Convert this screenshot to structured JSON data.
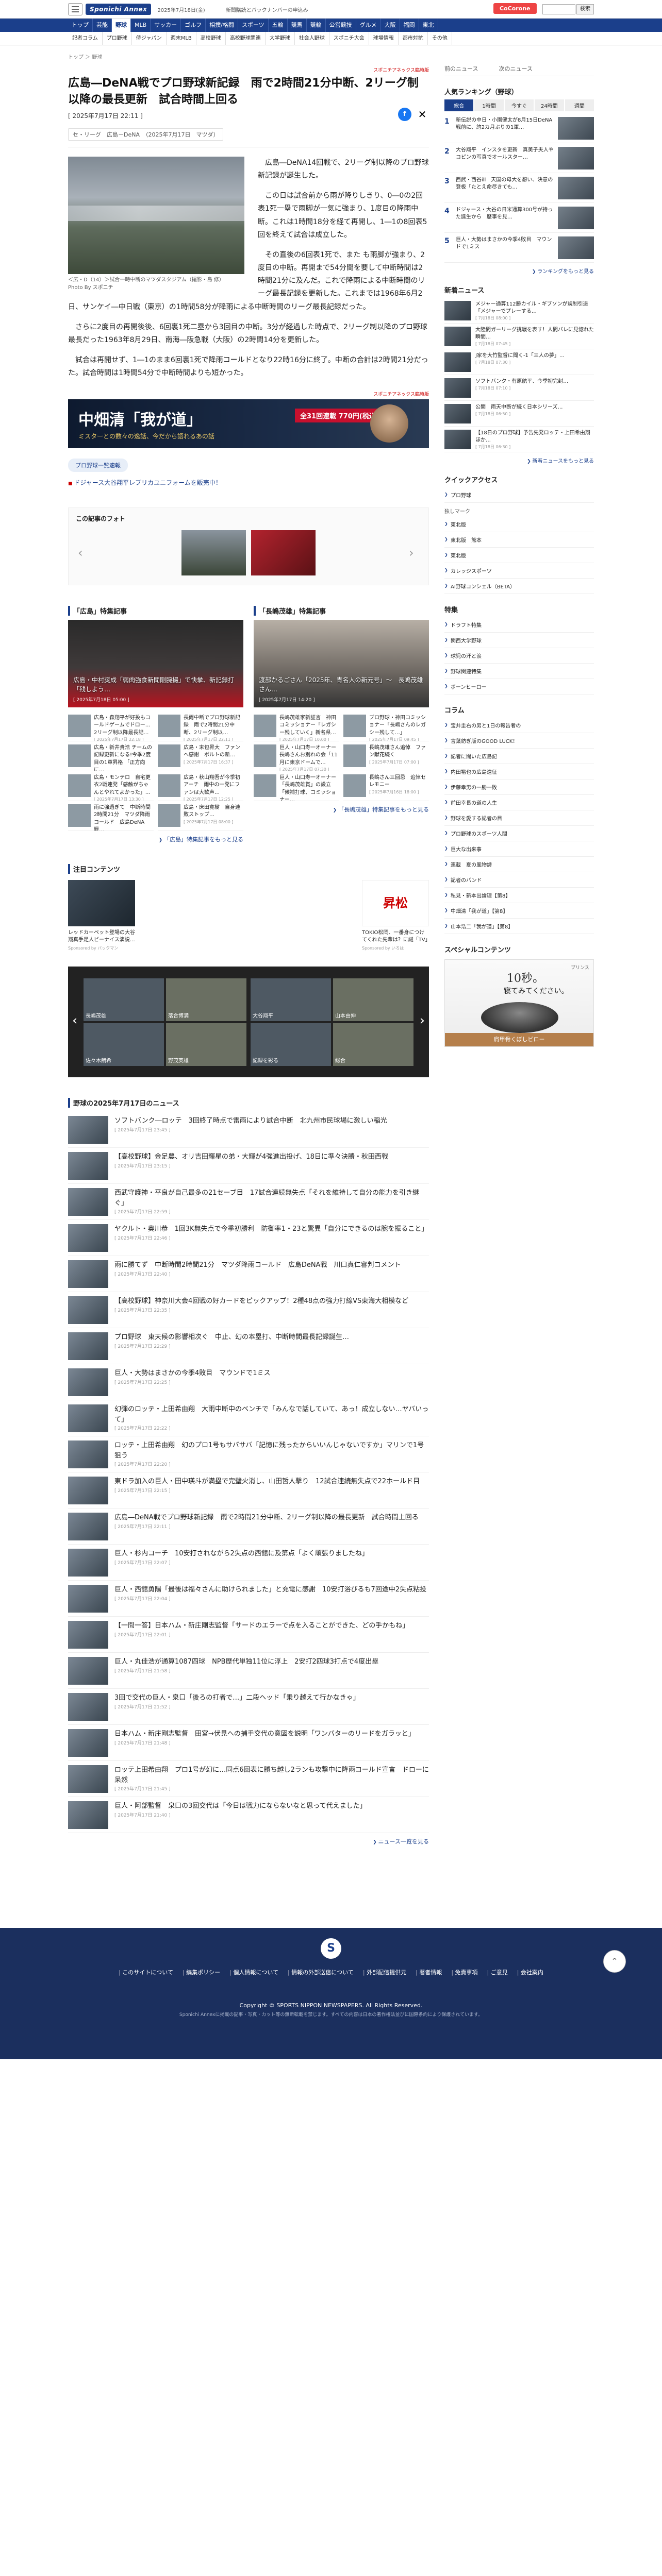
{
  "header": {
    "logo": "Sponichi Annex",
    "date": "2025年7月18日(金)",
    "notice": "新聞購読とバックナンバーの申込み",
    "cocorone": "CoCorone",
    "search_button": "検索"
  },
  "gnav": [
    "トップ",
    "芸能",
    "野球",
    "MLB",
    "サッカー",
    "ゴルフ",
    "相撲/格闘",
    "スポーツ",
    "五輪",
    "競馬",
    "競輪",
    "公営競技",
    "グルメ",
    "大阪",
    "福岡",
    "東北"
  ],
  "subnav": [
    "記者コラム",
    "プロ野球",
    "侍ジャパン",
    "週末MLB",
    "高校野球",
    "高校野球関連",
    "大学野球",
    "社会人野球",
    "スポニチ大会",
    "球場情報",
    "都市対抗",
    "その他"
  ],
  "breadcrumb": "トップ ＞ 野球",
  "ad_label": "スポニチアネックス臨時版",
  "article": {
    "headline": "広島―DeNA戦でプロ野球新記録　雨で2時間21分中断、2リーグ制以降の最長更新　試合時間上回る",
    "date": "[ 2025年7月17日 22:11 ]",
    "tags": [
      "セ・リーグ　広島－DeNA　（2025年7月17日　マツダ）"
    ],
    "photo_caption": "＜広・D（14）＞試合一時中断のマツダスタジアム（撮影・島 修）\nPhoto By スポニチ",
    "p1": "広島―DeNA14回戦で、2リーグ制以降のプロ野球新記録が誕生した。",
    "p2": "この日は試合前から雨が降りしきり、0―0の2回表1死一塁で雨脚が一気に強まり、1度目の降雨中断。これは1時間18分を経て再開し、1―1の8回表5回を終えて試合は成立した。",
    "p3": "その直後の6回表1死で、また も雨脚が強まり、2度目の中断。再開まで54分間を要して中断時間は2時間21分に及んだ。これで降雨による中断時間のリーグ最長記録を更新した。これまでは1968年6月2日、サンケイ―中日戦（東京）の1時間58分が降雨による中断時間のリーグ最長記録だった。",
    "p4": "さらに2度目の再開後後、6回裏1死二塁から3回目の中断。3分が経過した時点で、2リーグ制以降のプロ野球最長だった1963年8月29日、南海―阪急戦（大阪）の2時間14分を更新した。",
    "p5": "試合は再開せず、1―1のまま6回裏1死で降雨コールドとなり22時16分に終了。中断の合計は2時間21分だった。試合時間は1時間54分で中断時間よりも短かった。"
  },
  "banner": {
    "label": "スポニチアネックス臨時版",
    "title": "中畑清「我が道」",
    "subtitle": "ミスターとの数々の逸話、今だから語れるあの話",
    "price": "全31回連載 770円(税込)"
  },
  "pro_pill": "プロ野球一覧速報",
  "ext_link": "ドジャース大谷翔平レプリカユニフォームを販売中！",
  "photos": {
    "title": "この記事のフォト"
  },
  "features": [
    {
      "title": "「広島」特集記事",
      "hero_text": "広島・中村奨成「弱肉強食新聞剛腕撮」で快挙、新記録打 「残しよう…",
      "hero_date": "[ 2025年7月18日 05:00 ]",
      "items": [
        {
          "t": "広島・森翔平が好投もコールドゲームでドロー…2リーグ制以降最長記…",
          "d": "[ 2025年7月17日 22:18 ]"
        },
        {
          "t": "長雨中断でプロ野球新記録　雨で2時間21分中断、2リーグ制以…",
          "d": "[ 2025年7月17日 22:11 ]"
        },
        {
          "t": "広島・新井貴浩 チームの記録更新になる!今季2度目の1軍昇格 「正方向に…",
          "d": "[ 2025年7月17日 13:00 ]"
        },
        {
          "t": "広島・末包昇大　ファンへ感謝　ボルトの新…",
          "d": "[ 2025年7月17日 16:37 ]"
        },
        {
          "t": "広島・モンテロ　自宅更衣2戦連発「感触がちゃんとやれてよかった」…",
          "d": "[ 2025年7月17日 13:30 ]"
        },
        {
          "t": "広島・秋山翔吾が今季初アーチ　雨中の一発にファンは大歓声…",
          "d": "[ 2025年7月17日 12:25 ]"
        },
        {
          "t": "雨に強過ぎて　中断時間2時間21分　マツダ降雨コールド　広島DeNA戦…",
          "d": "[ 2025年7月17日 11:50 ]"
        },
        {
          "t": "広島・床田寛樹　自身連敗ストップ…",
          "d": "[ 2025年7月17日 08:00 ]"
        }
      ],
      "more": "「広島」特集記事をもっと見る"
    },
    {
      "title": "「長嶋茂雄」特集記事",
      "hero_text": "渡部かるごさん「2025年、青名人の新元号」～　長嶋茂雄さん…",
      "hero_date": "[ 2025年7月17日 14:20 ]",
      "items": [
        {
          "t": "長嶋茂雄家新証言　神田コミッショナー「レガシー残していく」新名県…",
          "d": "[ 2025年7月17日 10:00 ]"
        },
        {
          "t": "プロ野球・神田コミッショナー「長嶋さんのレガシー残して…」",
          "d": "[ 2025年7月17日 09:45 ]"
        },
        {
          "t": "巨人・山口寿一オーナー　長嶋さんお別れの会「11月に東京ドームで…",
          "d": "[ 2025年7月17日 07:30 ]"
        },
        {
          "t": "長嶋茂雄さん追悼　ファン献花続く",
          "d": "[ 2025年7月17日 07:00 ]"
        },
        {
          "t": "巨人・山口寿一オーナー「長嶋茂雄賞」の設立「候補打球、コミッショナー…",
          "d": "[ 2025年7月16日 20:00 ]"
        },
        {
          "t": "長嶋さん三回忌　追悼セレモニー",
          "d": "[ 2025年7月16日 18:00 ]"
        }
      ],
      "more": "「長嶋茂雄」特集記事をもっと見る"
    }
  ],
  "chumoku": {
    "title": "注目コンテンツ",
    "left_text": "レッドカーペット登場の大谷翔真手足人ビーナイス演説…",
    "left_by": "Sponsored by バックマン",
    "right_logo": "昇松",
    "right_text": "TOKIO松岡、一番身につけてくれた先輩は？に謎「TV」",
    "right_by": "Sponsored by いろは"
  },
  "carousel": [
    "長嶋茂雄",
    "落合博満",
    "佐々木朗希",
    "野茂英雄",
    "大谷翔平",
    "山本由伸",
    "記録を彩る",
    "総合"
  ],
  "newslist": {
    "title": "野球の2025年7月17日のニュース",
    "items": [
      {
        "t": "ソフトバンク―ロッテ　3回終了時点で雷雨により試合中断　北九州市民球場に激しい稲光",
        "d": "[ 2025年7月17日 23:45 ]"
      },
      {
        "t": "【高校野球】金足農、オリ吉田輝星の弟・大輝が4強進出投げ、18日に準々決勝・秋田西戦",
        "d": "[ 2025年7月17日 23:15 ]"
      },
      {
        "t": "西武守護神・平良が自己最多の21セーブ目　17試合連続無失点「それを維持して自分の能力を引き継ぐ」",
        "d": "[ 2025年7月17日 22:59 ]"
      },
      {
        "t": "ヤクルト・奥川恭　1回3K無失点で今季初勝利　防御率1・23と驚異「自分にできるのは腕を振ること」",
        "d": "[ 2025年7月17日 22:46 ]"
      },
      {
        "t": "雨に勝てず　中断時間2時間21分　マツダ降雨コールド　広島DeNA戦　川口真仁審判コメント",
        "d": "[ 2025年7月17日 22:40 ]"
      },
      {
        "t": "【高校野球】神奈川大会4回戦の好カードをピックアップ！2種48点の強力打線VS東海大相模など",
        "d": "[ 2025年7月17日 22:35 ]"
      },
      {
        "t": "プロ野球　東天候の影響相次ぐ　中止、幻の本塁打、中断時間最長記録誕生…",
        "d": "[ 2025年7月17日 22:29 ]"
      },
      {
        "t": "巨人・大勢はまさかの今季4敗目　マウンドで1ミス",
        "d": "[ 2025年7月17日 22:25 ]"
      },
      {
        "t": "幻弾のロッテ・上田希由翔　大雨中断中のベンチで「みんなで話していて、あっ！成立しない…ヤバいって」",
        "d": "[ 2025年7月17日 22:22 ]"
      },
      {
        "t": "ロッテ・上田希由翔　幻のプロ1号もサバサバ「記憶に残ったからいいんじゃないですか」マリンで1号狙う",
        "d": "[ 2025年7月17日 22:20 ]"
      },
      {
        "t": "東ドラ加入の巨人・田中瑛斗が満塁で完璧火消し、山田哲人撃り　12試合連続無失点で22ホールド目",
        "d": "[ 2025年7月17日 22:15 ]"
      },
      {
        "t": "広島―DeNA戦でプロ野球新記録　雨で2時間21分中断、2リーグ制以降の最長更新　試合時間上回る",
        "d": "[ 2025年7月17日 22:11 ]"
      },
      {
        "t": "巨人・杉内コーチ　10安打されながら2失点の西舘に及第点「よく頑張りましたね」",
        "d": "[ 2025年7月17日 22:07 ]"
      },
      {
        "t": "巨人・西舘勇陽「最後は福々さんに助けられました」と充電に感謝　10安打浴びるも7回途中2失点粘投",
        "d": "[ 2025年7月17日 22:04 ]"
      },
      {
        "t": "【一問一答】日本ハム・新庄剛志監督「サードのエラーで点を入ることができた、どの手かもね」",
        "d": "[ 2025年7月17日 22:01 ]"
      },
      {
        "t": "巨人・丸佳浩が通算1087四球　NPB歴代単独11位に浮上　2安打2四球3打点で4度出塁",
        "d": "[ 2025年7月17日 21:58 ]"
      },
      {
        "t": "3回で交代の巨人・泉口「後ろの打者で…」二段ヘッド「乗り越えて行かなきゃ」",
        "d": "[ 2025年7月17日 21:52 ]"
      },
      {
        "t": "日本ハム・新庄剛志監督　田宮→伏見への捕手交代の意図を説明「ワンバターのリードをガラッと」",
        "d": "[ 2025年7月17日 21:48 ]"
      },
      {
        "t": "ロッテ上田希由翔　プロ1号が幻に…同点6回表に勝ち越し2ランも攻撃中に降雨コールド宣言　ドローに呆然",
        "d": "[ 2025年7月17日 21:45 ]"
      },
      {
        "t": "巨人・阿部監督　泉口の3回交代は「今日は戦力にならないなと思って代えました」",
        "d": "[ 2025年7月17日 21:40 ]"
      }
    ],
    "more": "ニュース一覧を見る"
  },
  "side": {
    "top_links": [
      "前のニュース",
      "次のニュース"
    ],
    "ranking_title": "人気ランキング（野球）",
    "tabs": [
      "総合",
      "1時間",
      "今すぐ",
      "24時間",
      "週間"
    ],
    "ranks": [
      {
        "n": "1",
        "t": "新伝説の中日・小園健太が8月15日DeNA戦前に、約2カ月ぶりの1軍…"
      },
      {
        "n": "2",
        "t": "大谷翔平　インスタを更新　真美子夫人やコピンの写真でオールスター…"
      },
      {
        "n": "3",
        "t": "西武・西谷ill　天国の母大を想い、決意の登板「たとえ命尽きても…"
      },
      {
        "n": "4",
        "t": "ドジャース・大谷の日米通算300号が持った誕生から　歴事を見…"
      },
      {
        "n": "5",
        "t": "巨人・大勢はまさかの今季4敗目　マウンドで1ミス"
      }
    ],
    "ranking_more": "ランキングをもっと見る",
    "news_title": "新着ニュース",
    "news": [
      {
        "t": "メジャー通算112勝カイル・ギブソンが規制引退「メジャーでプレーする…",
        "d": "[ 7月18日 08:00 ]"
      },
      {
        "t": "大陸間ガーリーグ挑戦を表す！人間バレに見惚れた瞬間…",
        "d": "[ 7月18日 07:45 ]"
      },
      {
        "t": "J家を大竹監督に聞く-1「三人の夢」…",
        "d": "[ 7月18日 07:30 ]"
      },
      {
        "t": "ソフトバンク・有原航平、今季初完封…",
        "d": "[ 7月18日 07:10 ]"
      },
      {
        "t": "公開　雨天中断が続く日本シリーズ…",
        "d": "[ 7月18日 06:50 ]"
      },
      {
        "t": "【18日のプロ野球】予告先発ロッテ・上田希由翔ほか…",
        "d": "[ 7月18日 06:30 ]"
      }
    ],
    "news_more": "新着ニュースをもっと見る",
    "quick_title": "クイックアクセス",
    "quick": [
      "プロ野球"
    ],
    "bookmark_title": "独しマーク",
    "bookmarks": [
      "東北版",
      "東北版　熊本",
      "東北版",
      "カレッジスポーツ",
      "AI野球コンシェル（BETA）"
    ],
    "special_title": "特集",
    "specials": [
      "ドラフト特集",
      "関西大学野球",
      "球児の汗と涙",
      "野球関連特集",
      "ボーンヒーロー"
    ],
    "column_title": "コラム",
    "columns": [
      "宝井圭右の男と1日の報告者の",
      "言葉紡ぎ版のGOOD LUCK！",
      "記者に聞いた広島記",
      "内田裕也の広島遠征",
      "伊藤幸男の一勝一敗",
      "前田幸長の道の人生",
      "野球を愛する記者の目",
      "プロ野球のスポーツ人間",
      "巨大な出来事",
      "連載　夏の風物詩",
      "記者のバンド",
      "私見・新本出論理【第8】",
      "中畑清「我が道」【第8】",
      "山本浩二「我が道」【第8】"
    ],
    "special_content_title": "スペシャルコンテンツ",
    "sc_small": "プリンス",
    "sc_big1": "10秒。",
    "sc_big2": "寝てみてください。",
    "sc_bottom": "肩甲骨くぼしピロー"
  },
  "footer": {
    "links": [
      "このサイトについて",
      "編集ポリシー",
      "個人情報について",
      "情報の外部送信について",
      "外部配信提供元",
      "著者情報",
      "免責事項",
      "ご意見",
      "会社案内"
    ],
    "copyright": "Copyright © SPORTS NIPPON NEWSPAPERS. All Rights Reserved.",
    "copyright_sub": "Sponichi Annexに掲載の記事・写真・カット等の無断転載を禁じます。すべての内容は日本の著作権法並びに国際条約により保護されています。"
  }
}
